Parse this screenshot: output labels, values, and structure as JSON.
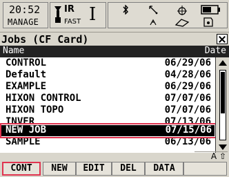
{
  "status": {
    "time": "20:52",
    "mode": "MANAGE",
    "ir_label": "IR",
    "fast_label": "FAST",
    "cursor_glyph": "I",
    "icons": [
      "prism-icon",
      "bluetooth-icon",
      "signal-icon",
      "target-icon",
      "battery-icon",
      "antenna-icon",
      "tilt-icon",
      "card-icon"
    ]
  },
  "title": "Jobs (CF Card)",
  "columns": {
    "name": "Name",
    "date": "Date"
  },
  "rows": [
    {
      "name": "CONTROL",
      "date": "06/29/06"
    },
    {
      "name": "Default",
      "date": "04/28/06"
    },
    {
      "name": "EXAMPLE",
      "date": "06/29/06"
    },
    {
      "name": "HIXON CONTROL",
      "date": "07/07/06"
    },
    {
      "name": "HIXON TOPO",
      "date": "07/07/06"
    },
    {
      "name": "INVER",
      "date": "07/13/06"
    },
    {
      "name": "NEW JOB",
      "date": "07/15/06"
    },
    {
      "name": "SAMPLE",
      "date": "06/13/06"
    }
  ],
  "input_mode": "A ⇧",
  "softkeys": [
    "CONT",
    "NEW",
    "EDIT",
    "DEL",
    "DATA"
  ],
  "colors": {
    "selection_highlight": "#e0334f",
    "background": "#d9d6cc"
  }
}
